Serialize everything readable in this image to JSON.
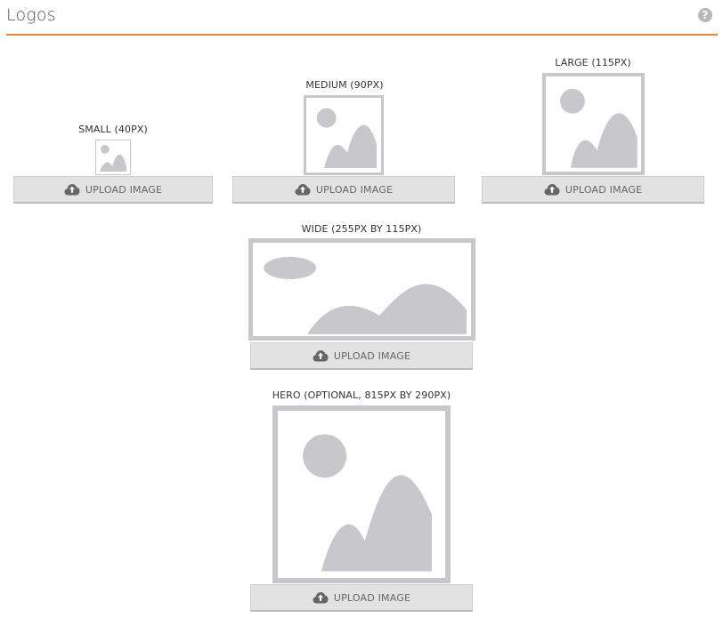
{
  "header": {
    "title": "Logos",
    "help_icon": "?"
  },
  "colors": {
    "accent": "#e8862e",
    "placeholder": "#c8c8cc"
  },
  "upload_label": "UPLOAD IMAGE",
  "slots": {
    "small": {
      "label": "SMALL (40PX)"
    },
    "medium": {
      "label": "MEDIUM (90PX)"
    },
    "large": {
      "label": "LARGE (115PX)"
    },
    "wide": {
      "label": "WIDE (255PX BY 115PX)"
    },
    "hero": {
      "label": "HERO (OPTIONAL, 815PX BY 290PX)"
    }
  }
}
